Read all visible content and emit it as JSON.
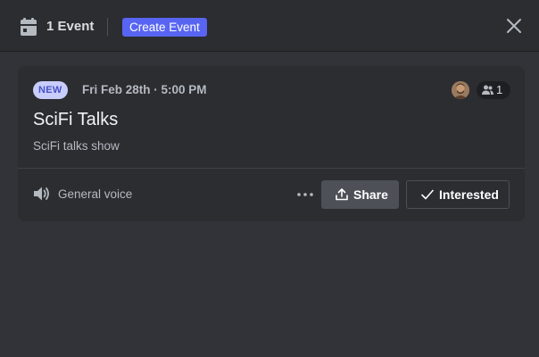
{
  "header": {
    "event_count": "1 Event",
    "create_label": "Create Event"
  },
  "event": {
    "badge": "NEW",
    "datetime": "Fri Feb 28th · 5:00 PM",
    "interested_count": "1",
    "title": "SciFi Talks",
    "description": "SciFi talks show",
    "channel": "General voice"
  },
  "actions": {
    "share_label": "Share",
    "interested_label": "Interested"
  },
  "colors": {
    "accent": "#5865f2",
    "badge_bg": "#c9cdfb",
    "badge_text": "#4752c4"
  },
  "icons": {
    "calendar": "calendar-icon",
    "close": "close-icon",
    "people": "people-icon",
    "speaker": "speaker-icon",
    "more": "more-icon",
    "share": "share-icon",
    "check": "check-icon"
  }
}
